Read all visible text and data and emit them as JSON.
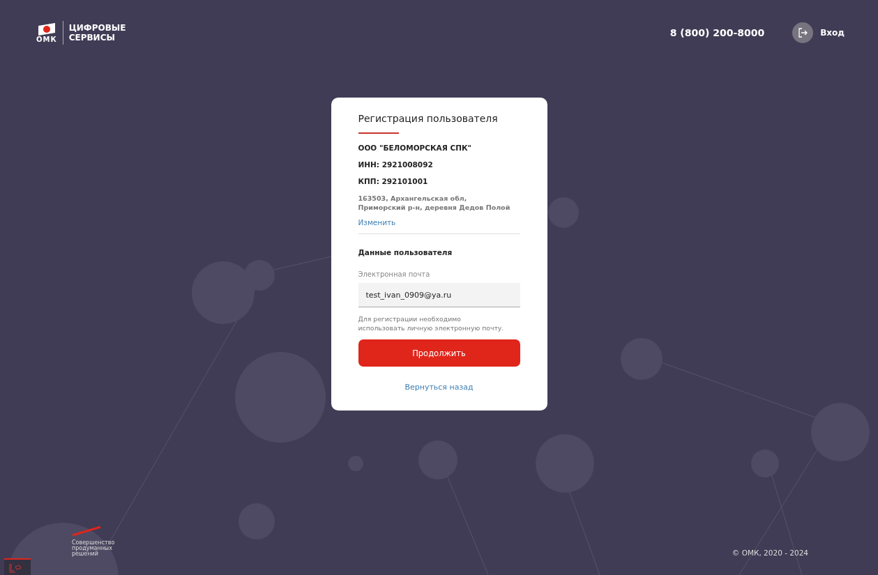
{
  "header": {
    "logo_abbr": "ОМК",
    "logo_lines": [
      "ЦИФРОВЫЕ",
      "СЕРВИСЫ"
    ],
    "phone": "8 (800) 200-8000",
    "login": "Вход"
  },
  "card": {
    "title": "Регистрация пользователя",
    "company": "ООО \"БЕЛОМОРСКАЯ СПК\"",
    "inn": "ИНН: 2921008092",
    "kpp": "КПП: 292101001",
    "address_lines": [
      "163503, Архангельская обл,",
      "Приморский р-н, деревня Дедов Полой"
    ],
    "change_link": "Изменить",
    "section_title": "Данные пользователя",
    "email": {
      "label": "Электронная почта",
      "value": "test_ivan_0909@ya.ru"
    },
    "hint_lines": [
      "Для регистрации необходимо",
      "использовать личную электронную почту."
    ],
    "submit": "Продолжить",
    "back": "Вернуться назад"
  },
  "footer": {
    "tagline_lines": [
      "Совершенство",
      "продуманных",
      "решений"
    ],
    "copyright": "© ОМК, 2020 - 2024"
  }
}
